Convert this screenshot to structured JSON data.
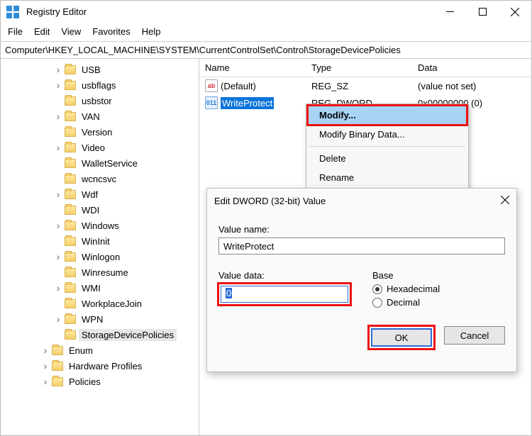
{
  "window": {
    "title": "Registry Editor"
  },
  "menu": {
    "file": "File",
    "edit": "Edit",
    "view": "View",
    "favorites": "Favorites",
    "help": "Help"
  },
  "address": "Computer\\HKEY_LOCAL_MACHINE\\SYSTEM\\CurrentControlSet\\Control\\StorageDevicePolicies",
  "tree": [
    {
      "indent": 3,
      "twisty": "right",
      "label": "USB"
    },
    {
      "indent": 3,
      "twisty": "right",
      "label": "usbflags"
    },
    {
      "indent": 3,
      "twisty": "none",
      "label": "usbstor"
    },
    {
      "indent": 3,
      "twisty": "right",
      "label": "VAN"
    },
    {
      "indent": 3,
      "twisty": "none",
      "label": "Version"
    },
    {
      "indent": 3,
      "twisty": "right",
      "label": "Video"
    },
    {
      "indent": 3,
      "twisty": "none",
      "label": "WalletService"
    },
    {
      "indent": 3,
      "twisty": "none",
      "label": "wcncsvc"
    },
    {
      "indent": 3,
      "twisty": "right",
      "label": "Wdf"
    },
    {
      "indent": 3,
      "twisty": "none",
      "label": "WDI"
    },
    {
      "indent": 3,
      "twisty": "right",
      "label": "Windows"
    },
    {
      "indent": 3,
      "twisty": "none",
      "label": "WinInit"
    },
    {
      "indent": 3,
      "twisty": "right",
      "label": "Winlogon"
    },
    {
      "indent": 3,
      "twisty": "none",
      "label": "Winresume"
    },
    {
      "indent": 3,
      "twisty": "right",
      "label": "WMI"
    },
    {
      "indent": 3,
      "twisty": "none",
      "label": "WorkplaceJoin"
    },
    {
      "indent": 3,
      "twisty": "right",
      "label": "WPN"
    },
    {
      "indent": 3,
      "twisty": "none",
      "label": "StorageDevicePolicies",
      "selected": true
    },
    {
      "indent": 2,
      "twisty": "right",
      "label": "Enum"
    },
    {
      "indent": 2,
      "twisty": "right",
      "label": "Hardware Profiles"
    },
    {
      "indent": 2,
      "twisty": "right",
      "label": "Policies"
    }
  ],
  "list": {
    "headers": {
      "name": "Name",
      "type": "Type",
      "data": "Data"
    },
    "rows": [
      {
        "icon": "sz",
        "name": "(Default)",
        "type": "REG_SZ",
        "data": "(value not set)",
        "selected": false
      },
      {
        "icon": "dword",
        "name": "WriteProtect",
        "type": "REG_DWORD",
        "data": "0x00000000 (0)",
        "selected": true
      }
    ]
  },
  "context_menu": {
    "items": [
      {
        "label": "Modify...",
        "highlight": true
      },
      {
        "label": "Modify Binary Data..."
      },
      {
        "sep": true
      },
      {
        "label": "Delete"
      },
      {
        "label": "Rename"
      }
    ]
  },
  "dialog": {
    "title": "Edit DWORD (32-bit) Value",
    "value_name_label": "Value name:",
    "value_name": "WriteProtect",
    "value_data_label": "Value data:",
    "value_data": "0",
    "base_label": "Base",
    "radio_hex": "Hexadecimal",
    "radio_dec": "Decimal",
    "ok": "OK",
    "cancel": "Cancel"
  }
}
